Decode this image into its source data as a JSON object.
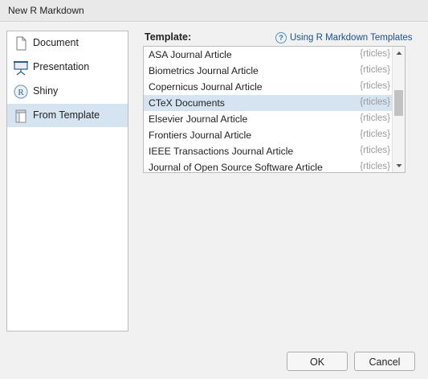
{
  "window": {
    "title": "New R Markdown"
  },
  "sidebar": {
    "items": [
      {
        "label": "Document",
        "icon": "document-icon",
        "selected": false
      },
      {
        "label": "Presentation",
        "icon": "presentation-icon",
        "selected": false
      },
      {
        "label": "Shiny",
        "icon": "shiny-icon",
        "selected": false
      },
      {
        "label": "From Template",
        "icon": "template-icon",
        "selected": true
      }
    ]
  },
  "main": {
    "template_label": "Template:",
    "help_link": {
      "icon": "help-icon",
      "label": "Using R Markdown Templates"
    },
    "templates": [
      {
        "name": "ASA Journal Article",
        "package": "{rticles}"
      },
      {
        "name": "Biometrics Journal Article",
        "package": "{rticles}"
      },
      {
        "name": "Copernicus Journal Article",
        "package": "{rticles}"
      },
      {
        "name": "CTeX Documents",
        "package": "{rticles}",
        "selected": true
      },
      {
        "name": "Elsevier Journal Article",
        "package": "{rticles}"
      },
      {
        "name": "Frontiers Journal Article",
        "package": "{rticles}"
      },
      {
        "name": "IEEE Transactions Journal Article",
        "package": "{rticles}"
      },
      {
        "name": "Journal of Open Source Software Article",
        "package": "{rticles}"
      }
    ]
  },
  "buttons": {
    "ok": "OK",
    "cancel": "Cancel"
  },
  "colors": {
    "selection": "#d6e3f0",
    "link": "#1a4f8b",
    "package_text": "#9a9a9a"
  }
}
